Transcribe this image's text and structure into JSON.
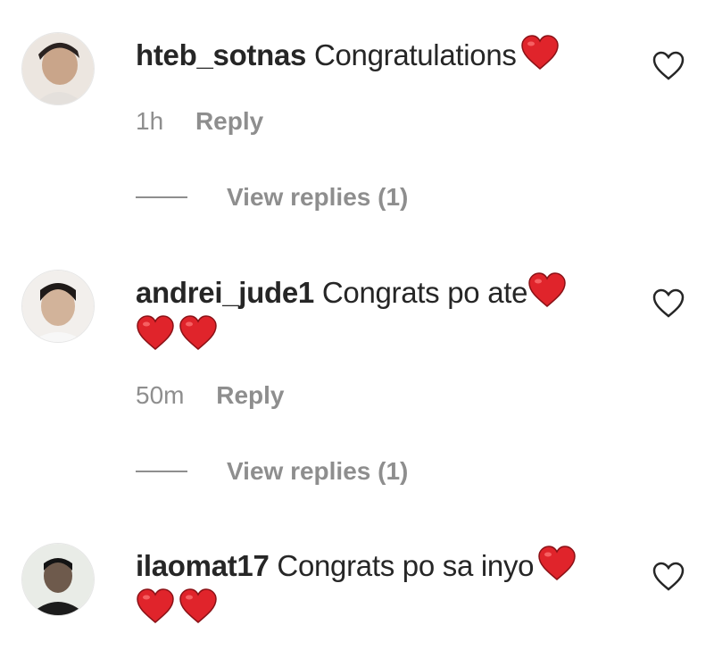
{
  "comments": [
    {
      "username": "hteb_sotnas",
      "text": "Congratulations",
      "time": "1h",
      "reply_label": "Reply",
      "view_replies": "View replies (1)"
    },
    {
      "username": "andrei_jude1",
      "text": "Congrats po ate",
      "time": "50m",
      "reply_label": "Reply",
      "view_replies": "View replies (1)"
    },
    {
      "username": "ilaomat17",
      "text": "Congrats po sa inyo",
      "time": "",
      "reply_label": "",
      "view_replies": ""
    }
  ],
  "colors": {
    "heart_emoji": "#e0242b",
    "muted_text": "#8e8e8e",
    "primary_text": "#262626"
  },
  "icons": {
    "like": "heart-outline-icon",
    "emoji": "red-heart-emoji"
  }
}
